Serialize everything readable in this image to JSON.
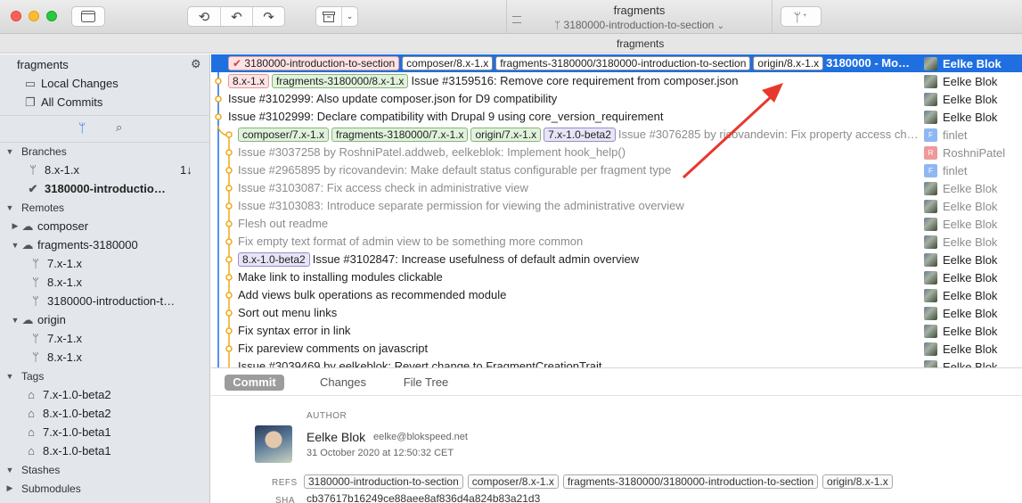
{
  "app": {
    "title": "fragments",
    "branch_path": "3180000-introduction-to-section",
    "window_title": "fragments"
  },
  "colors": {
    "selection": "#1f6fe0",
    "arrow": "#e8382e",
    "graph_blue": "#1f6fe0",
    "graph_orange": "#f0a818"
  },
  "sidebar": {
    "repo_name": "fragments",
    "local_changes": "Local Changes",
    "all_commits": "All Commits",
    "branches_header": "Branches",
    "branches": [
      {
        "name": "8.x-1.x",
        "status": "1↓"
      },
      {
        "name": "3180000-introductio…",
        "current": true
      }
    ],
    "remotes_header": "Remotes",
    "remotes": [
      {
        "name": "composer",
        "branches": []
      },
      {
        "name": "fragments-3180000",
        "branches": [
          "7.x-1.x",
          "8.x-1.x",
          "3180000-introduction-t…"
        ]
      },
      {
        "name": "origin",
        "branches": [
          "7.x-1.x",
          "8.x-1.x"
        ]
      }
    ],
    "tags_header": "Tags",
    "tags": [
      "7.x-1.0-beta2",
      "8.x-1.0-beta2",
      "7.x-1.0-beta1",
      "8.x-1.0-beta1"
    ],
    "stashes_header": "Stashes",
    "submodules_header": "Submodules"
  },
  "commits": [
    {
      "refs": [
        {
          "text": "3180000-introduction-to-section",
          "kind": "cur"
        },
        {
          "text": "composer/8.x-1.x",
          "kind": "wht"
        },
        {
          "text": "fragments-3180000/3180000-introduction-to-section",
          "kind": "wht"
        },
        {
          "text": "origin/8.x-1.x",
          "kind": "wht"
        }
      ],
      "message": "3180000 - Mo…",
      "author": "Eelke Blok",
      "avatar": "photo",
      "selected": true
    },
    {
      "refs": [
        {
          "text": "8.x-1.x",
          "kind": "loc"
        },
        {
          "text": "fragments-3180000/8.x-1.x",
          "kind": "grn"
        }
      ],
      "message": "Issue #3159516: Remove core requirement from composer.json",
      "author": "Eelke Blok",
      "avatar": "photo"
    },
    {
      "refs": [],
      "message": "Issue #3102999: Also update composer.json for D9 compatibility",
      "author": "Eelke Blok",
      "avatar": "photo"
    },
    {
      "refs": [],
      "message": "Issue #3102999: Declare compatibility with Drupal 9 using core_version_requirement",
      "author": "Eelke Blok",
      "avatar": "photo"
    },
    {
      "refs": [
        {
          "text": "composer/7.x-1.x",
          "kind": "grn"
        },
        {
          "text": "fragments-3180000/7.x-1.x",
          "kind": "grn"
        },
        {
          "text": "origin/7.x-1.x",
          "kind": "grn"
        },
        {
          "text": "7.x-1.0-beta2",
          "kind": "pur"
        }
      ],
      "message": "Issue #3076285 by ricovandevin: Fix property access ch…",
      "author": "finlet",
      "avatar": "F",
      "grey": true
    },
    {
      "refs": [],
      "message": "Issue #3037258 by RoshniPatel.addweb, eelkeblok: Implement hook_help()",
      "author": "RoshniPatel",
      "avatar": "R",
      "grey": true
    },
    {
      "refs": [],
      "message": "Issue #2965895 by ricovandevin: Make default status configurable per fragment type",
      "author": "finlet",
      "avatar": "F",
      "grey": true
    },
    {
      "refs": [],
      "message": "Issue #3103087: Fix access check in administrative view",
      "author": "Eelke Blok",
      "avatar": "photo",
      "grey": true
    },
    {
      "refs": [],
      "message": "Issue #3103083: Introduce separate permission for viewing the administrative overview",
      "author": "Eelke Blok",
      "avatar": "photo",
      "grey": true
    },
    {
      "refs": [],
      "message": "Flesh out readme",
      "author": "Eelke Blok",
      "avatar": "photo",
      "grey": true
    },
    {
      "refs": [],
      "message": "Fix empty text format of admin view to be something more common",
      "author": "Eelke Blok",
      "avatar": "photo",
      "grey": true
    },
    {
      "refs": [
        {
          "text": "8.x-1.0-beta2",
          "kind": "pur"
        }
      ],
      "message": "Issue #3102847: Increase usefulness of default admin overview",
      "author": "Eelke Blok",
      "avatar": "photo"
    },
    {
      "refs": [],
      "message": "Make link to installing modules clickable",
      "author": "Eelke Blok",
      "avatar": "photo"
    },
    {
      "refs": [],
      "message": "Add views bulk operations as recommended module",
      "author": "Eelke Blok",
      "avatar": "photo"
    },
    {
      "refs": [],
      "message": "Sort out menu links",
      "author": "Eelke Blok",
      "avatar": "photo"
    },
    {
      "refs": [],
      "message": "Fix syntax error in link",
      "author": "Eelke Blok",
      "avatar": "photo"
    },
    {
      "refs": [],
      "message": "Fix pareview comments on javascript",
      "author": "Eelke Blok",
      "avatar": "photo"
    },
    {
      "refs": [],
      "message": "Issue #3039469 by eelkeblok: Revert change to FragmentCreationTrait",
      "author": "Eelke Blok",
      "avatar": "photo"
    }
  ],
  "details": {
    "tabs": [
      "Commit",
      "Changes",
      "File Tree"
    ],
    "active_tab": 0,
    "author_label": "AUTHOR",
    "author_name": "Eelke Blok",
    "author_email": "eelke@blokspeed.net",
    "date": "31 October 2020 at 12:50:32 CET",
    "refs_label": "REFS",
    "refs": [
      "3180000-introduction-to-section",
      "composer/8.x-1.x",
      "fragments-3180000/3180000-introduction-to-section",
      "origin/8.x-1.x"
    ],
    "sha_label": "SHA",
    "sha": "cb37617b16249ce88aee8af836d4a824b83a21d3"
  }
}
